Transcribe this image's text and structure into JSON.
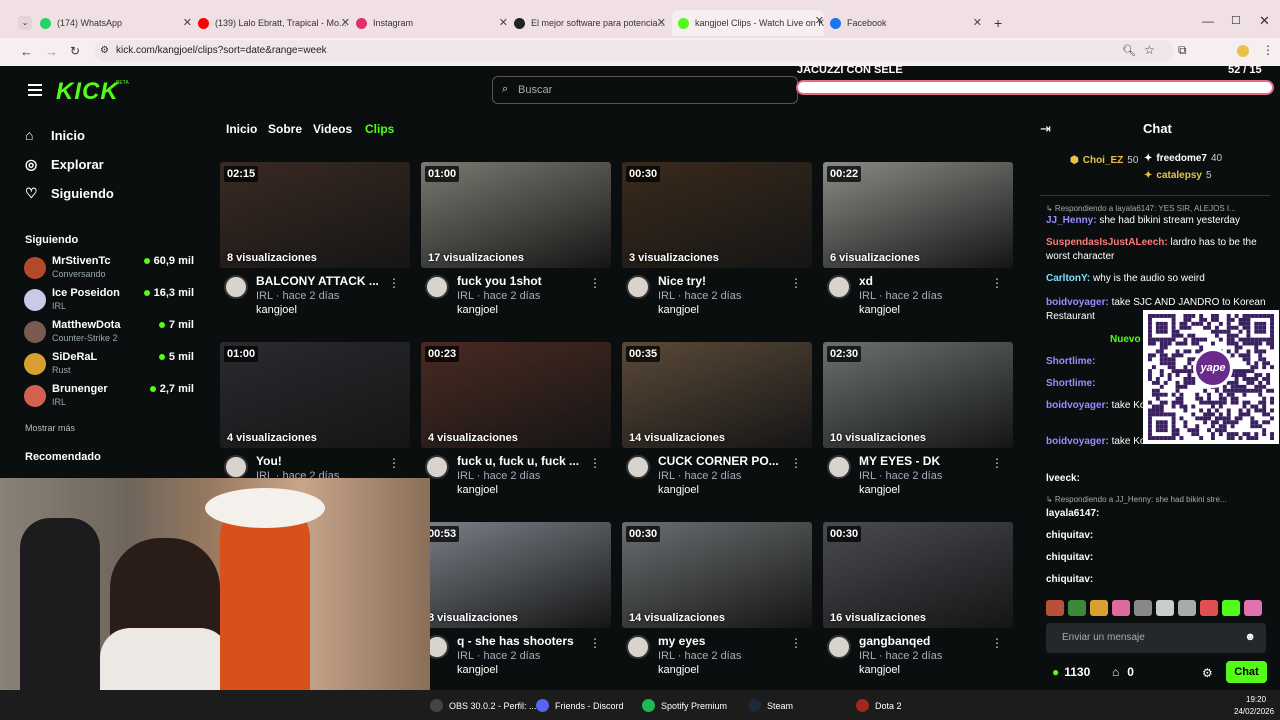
{
  "browser": {
    "tabs": [
      {
        "title": "(174) WhatsApp",
        "color": "#25d366"
      },
      {
        "title": "(139) Lalo Ebratt, Trapical - Mo...",
        "color": "#ff0000"
      },
      {
        "title": "Instagram",
        "color": "#e1306c"
      },
      {
        "title": "El mejor software para potencia...",
        "color": "#222222"
      },
      {
        "title": "kangjoel Clips - Watch Live on K...",
        "color": "#53fc18"
      },
      {
        "title": "Facebook",
        "color": "#1877f2"
      }
    ],
    "url": "kick.com/kangjoel/clips?sort=date&range=week"
  },
  "header": {
    "logo": "KICK",
    "logo_beta": "BETA",
    "search_placeholder": "Buscar",
    "overlay_goal_title": "JACUZZI CON SELE",
    "overlay_goal_count": "52 / 15"
  },
  "sidebar": {
    "nav": [
      {
        "label": "Inicio",
        "icon": "home-icon"
      },
      {
        "label": "Explorar",
        "icon": "compass-icon"
      },
      {
        "label": "Siguiendo",
        "icon": "heart-icon"
      }
    ],
    "following_title": "Siguiendo",
    "channels": [
      {
        "name": "MrStivenTc",
        "category": "Conversando",
        "viewers": "60,9 mil",
        "color": "#b34a2a"
      },
      {
        "name": "Ice Poseidon",
        "category": "IRL",
        "viewers": "16,3 mil",
        "color": "#c9c9e8"
      },
      {
        "name": "MatthewDota",
        "category": "Counter-Strike 2",
        "viewers": "7 mil",
        "color": "#7a5a50"
      },
      {
        "name": "SiDeRaL",
        "category": "Rust",
        "viewers": "5 mil",
        "color": "#d8a030"
      },
      {
        "name": "Brunenger",
        "category": "IRL",
        "viewers": "2,7 mil",
        "color": "#d46050"
      }
    ],
    "show_more": "Mostrar más",
    "recommended_title": "Recomendado"
  },
  "channel_tabs": [
    "Inicio",
    "Sobre",
    "Videos",
    "Clips"
  ],
  "clips": [
    {
      "duration": "02:15",
      "views": "8 visualizaciones",
      "title": "BALCONY ATTACK ...",
      "meta": "IRL · hace 2 días",
      "user": "kangjoel",
      "bg": "#3a2a22"
    },
    {
      "duration": "01:00",
      "views": "17 visualizaciones",
      "title": "fuck you 1shot",
      "meta": "IRL · hace 2 días",
      "user": "kangjoel",
      "bg": "#7a7a72"
    },
    {
      "duration": "00:30",
      "views": "3 visualizaciones",
      "title": "Nice try!",
      "meta": "IRL · hace 2 días",
      "user": "kangjoel",
      "bg": "#3a2a1c"
    },
    {
      "duration": "00:22",
      "views": "6 visualizaciones",
      "title": "xd",
      "meta": "IRL · hace 2 días",
      "user": "kangjoel",
      "bg": "#8a8a86"
    },
    {
      "duration": "01:00",
      "views": "4 visualizaciones",
      "title": "You!",
      "meta": "IRL · hace 2 días",
      "user": "kangjoel",
      "bg": "#2a2a30"
    },
    {
      "duration": "00:23",
      "views": "4 visualizaciones",
      "title": "fuck u, fuck u, fuck ...",
      "meta": "IRL · hace 2 días",
      "user": "kangjoel",
      "bg": "#4a2a22"
    },
    {
      "duration": "00:35",
      "views": "14 visualizaciones",
      "title": "CUCK CORNER PO...",
      "meta": "IRL · hace 2 días",
      "user": "kangjoel",
      "bg": "#5a4a38"
    },
    {
      "duration": "02:30",
      "views": "10 visualizaciones",
      "title": "MY EYES - DK",
      "meta": "IRL · hace 2 días",
      "user": "kangjoel",
      "bg": "#6a7070"
    },
    {
      "duration": "00:53",
      "views": "8 visualizaciones",
      "title": "q - she has shooters",
      "meta": "IRL · hace 2 días",
      "user": "kangjoel",
      "bg": "#7a8088"
    },
    {
      "duration": "00:30",
      "views": "14 visualizaciones",
      "title": "my eyes",
      "meta": "IRL · hace 2 días",
      "user": "kangjoel",
      "bg": "#6a6e70"
    },
    {
      "duration": "00:30",
      "views": "16 visualizaciones",
      "title": "gangbanqed",
      "meta": "IRL · hace 2 días",
      "user": "kangjoel",
      "bg": "#4a4a52"
    }
  ],
  "chat": {
    "title": "Chat",
    "top_gifters": [
      {
        "name": "Choi_EZ",
        "count": "50",
        "color": "#e8c34a"
      },
      {
        "name": "freedome7",
        "count": "40",
        "color": "#ffffff"
      },
      {
        "name": "catalepsy",
        "count": "5",
        "color": "#e8c34a"
      }
    ],
    "messages": [
      {
        "user": "",
        "text": "↳ Respondiendo a layala6147: YES SIR, ALEJOS I...",
        "color": "#aaaaaa"
      },
      {
        "user": "JJ_Henny:",
        "text": " she had bikini stream yesterday",
        "color": "#9a8cff"
      },
      {
        "user": "SuspendasIsJustALeech:",
        "text": " lardro has to be the worst character",
        "color": "#ff7a7a"
      },
      {
        "user": "CarltonY:",
        "text": " why is the audio so weird",
        "color": "#7ae0ff"
      },
      {
        "user": "boidvoyager:",
        "text": " take SJC AND JANDRO to Korean Restaurant",
        "color": "#9a8cff"
      },
      {
        "user": "Shortlime:",
        "text": "",
        "color": "#9a8cff"
      },
      {
        "user": "Shortlime:",
        "text": "",
        "color": "#9a8cff"
      },
      {
        "user": "boidvoyager:",
        "text": " take Korean Restaurant",
        "color": "#9a8cff"
      },
      {
        "user": "boidvoyager:",
        "text": " take Korean Restaurant",
        "color": "#9a8cff"
      },
      {
        "user": "lveeck:",
        "text": "",
        "color": "#ffffff"
      },
      {
        "user": "",
        "text": "↳ Respondiendo a JJ_Henny: she had bikini stre...",
        "color": "#aaaaaa"
      },
      {
        "user": "layala6147:",
        "text": "",
        "color": "#ffffff"
      },
      {
        "user": "chiquitav:",
        "text": "",
        "color": "#ffffff"
      },
      {
        "user": "chiquitav:",
        "text": "",
        "color": "#ffffff"
      },
      {
        "user": "chiquitav:",
        "text": "",
        "color": "#ffffff"
      }
    ],
    "new_label": "Nuevo",
    "input_placeholder": "Enviar un mensaje",
    "points": "1130",
    "gifts": "0",
    "send_label": "Chat",
    "qr_brand": "yape"
  },
  "taskbar": {
    "items": [
      {
        "label": "OBS 30.0.2 - Perfil: ...",
        "color": "#444444"
      },
      {
        "label": "Friends - Discord",
        "color": "#5865f2"
      },
      {
        "label": "Spotify Premium",
        "color": "#1db954"
      },
      {
        "label": "Steam",
        "color": "#1b2838"
      },
      {
        "label": "Dota 2",
        "color": "#a0281e"
      }
    ],
    "time": "19:20",
    "date": "24/02/2026"
  },
  "accent": "#53fc18"
}
